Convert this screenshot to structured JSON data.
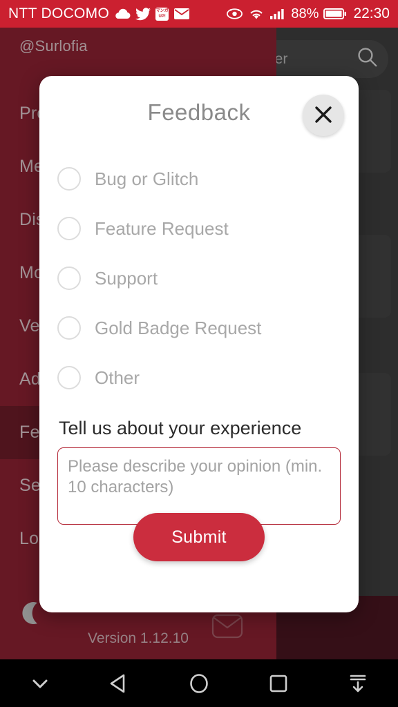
{
  "statusbar": {
    "carrier": "NTT DOCOMO",
    "icons": [
      "cloud-icon",
      "twitter-icon",
      "manga-up-icon",
      "envelope-icon"
    ],
    "manga_app_line1": "マンガ",
    "manga_app_line2": "UP!",
    "right_icons": [
      "eye-icon",
      "wifi-icon",
      "signal-icon"
    ],
    "battery_percent": "88%",
    "time": "22:30",
    "bg_color": "#CB2030"
  },
  "drawer": {
    "username": "@Surlofia",
    "items": [
      {
        "label": "Profile",
        "selected": false
      },
      {
        "label": "Messages",
        "selected": false
      },
      {
        "label": "Discover",
        "selected": false
      },
      {
        "label": "More",
        "selected": false
      },
      {
        "label": "Verification",
        "selected": false
      },
      {
        "label": "Admin",
        "selected": false
      },
      {
        "label": "Feedback",
        "selected": true
      },
      {
        "label": "Settings",
        "selected": false
      },
      {
        "label": "Logout",
        "selected": false
      }
    ],
    "version": "Version 1.12.10",
    "theme_toggle_icon": "moon-icon",
    "bg_color": "#8E2233",
    "selected_color": "#6E1C29"
  },
  "background": {
    "search_text": "der",
    "search_icon": "search-icon",
    "mail_icon": "envelope-icon"
  },
  "dialog": {
    "title": "Feedback",
    "close_icon": "close-icon",
    "options": [
      {
        "label": "Bug or Glitch",
        "selected": false
      },
      {
        "label": "Feature Request",
        "selected": false
      },
      {
        "label": "Support",
        "selected": false
      },
      {
        "label": "Gold Badge Request",
        "selected": false
      },
      {
        "label": "Other",
        "selected": false
      }
    ],
    "experience_heading": "Tell us about your experience",
    "feedback_value": "",
    "feedback_placeholder": "Please describe your opinion (min. 10 characters)",
    "submit_label": "Submit",
    "accent_color": "#CB2D3E",
    "border_color": "#b52b3a"
  },
  "navbar": {
    "buttons": [
      {
        "name": "collapse-keyboard-icon"
      },
      {
        "name": "back-icon"
      },
      {
        "name": "home-icon"
      },
      {
        "name": "recents-icon"
      },
      {
        "name": "download-icon"
      }
    ]
  }
}
